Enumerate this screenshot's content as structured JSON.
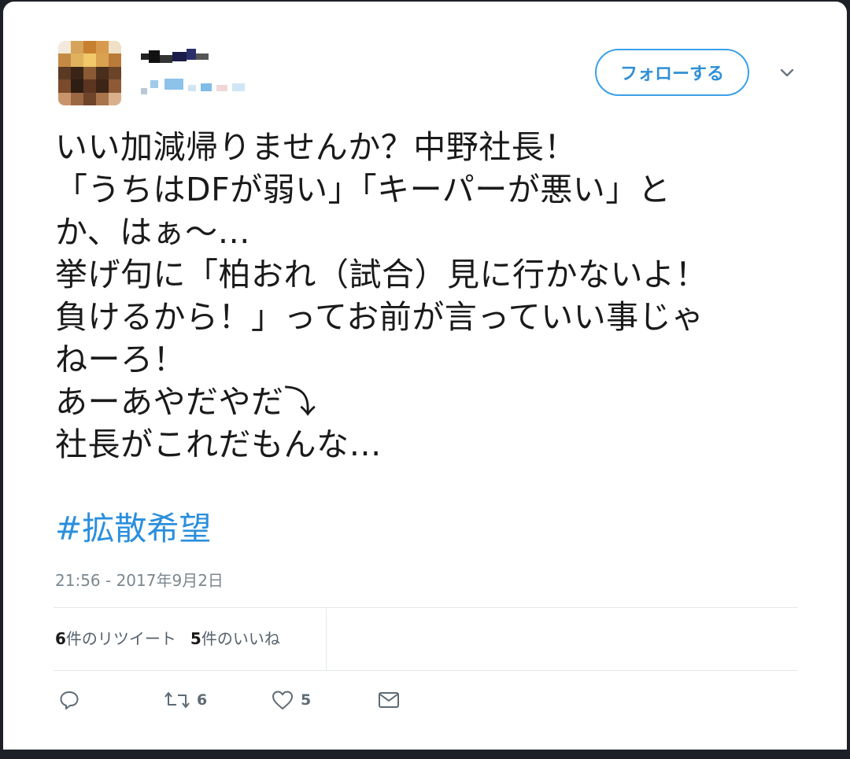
{
  "tweet": {
    "follow_label": "フォローする",
    "text_lines": [
      "いい加減帰りませんか？中野社長！",
      "「うちはDFが弱い」「キーパーが悪い」と",
      "か、はぁ〜…",
      "挙げ句に「柏おれ（試合）見に行かないよ！",
      "負けるから！」ってお前が言っていい事じゃ",
      "ねーろ！",
      "あーあやだやだ⤵",
      "社長がこれだもんな…"
    ],
    "hashtag": "#拡散希望",
    "timestamp": "21:56 - 2017年9月2日",
    "stats": {
      "retweets_count": "6",
      "retweets_label": "件のリツイート",
      "likes_count": "5",
      "likes_label": "件のいいね"
    },
    "actions": {
      "retweet_count": "6",
      "like_count": "5"
    }
  },
  "icons": [
    "chevron-down-icon",
    "reply-icon",
    "retweet-icon",
    "heart-icon",
    "message-icon"
  ],
  "colors": {
    "accent": "#2a8fdd",
    "text": "#1a1a1a",
    "muted": "#7b8790",
    "frame": "#1d2127"
  }
}
